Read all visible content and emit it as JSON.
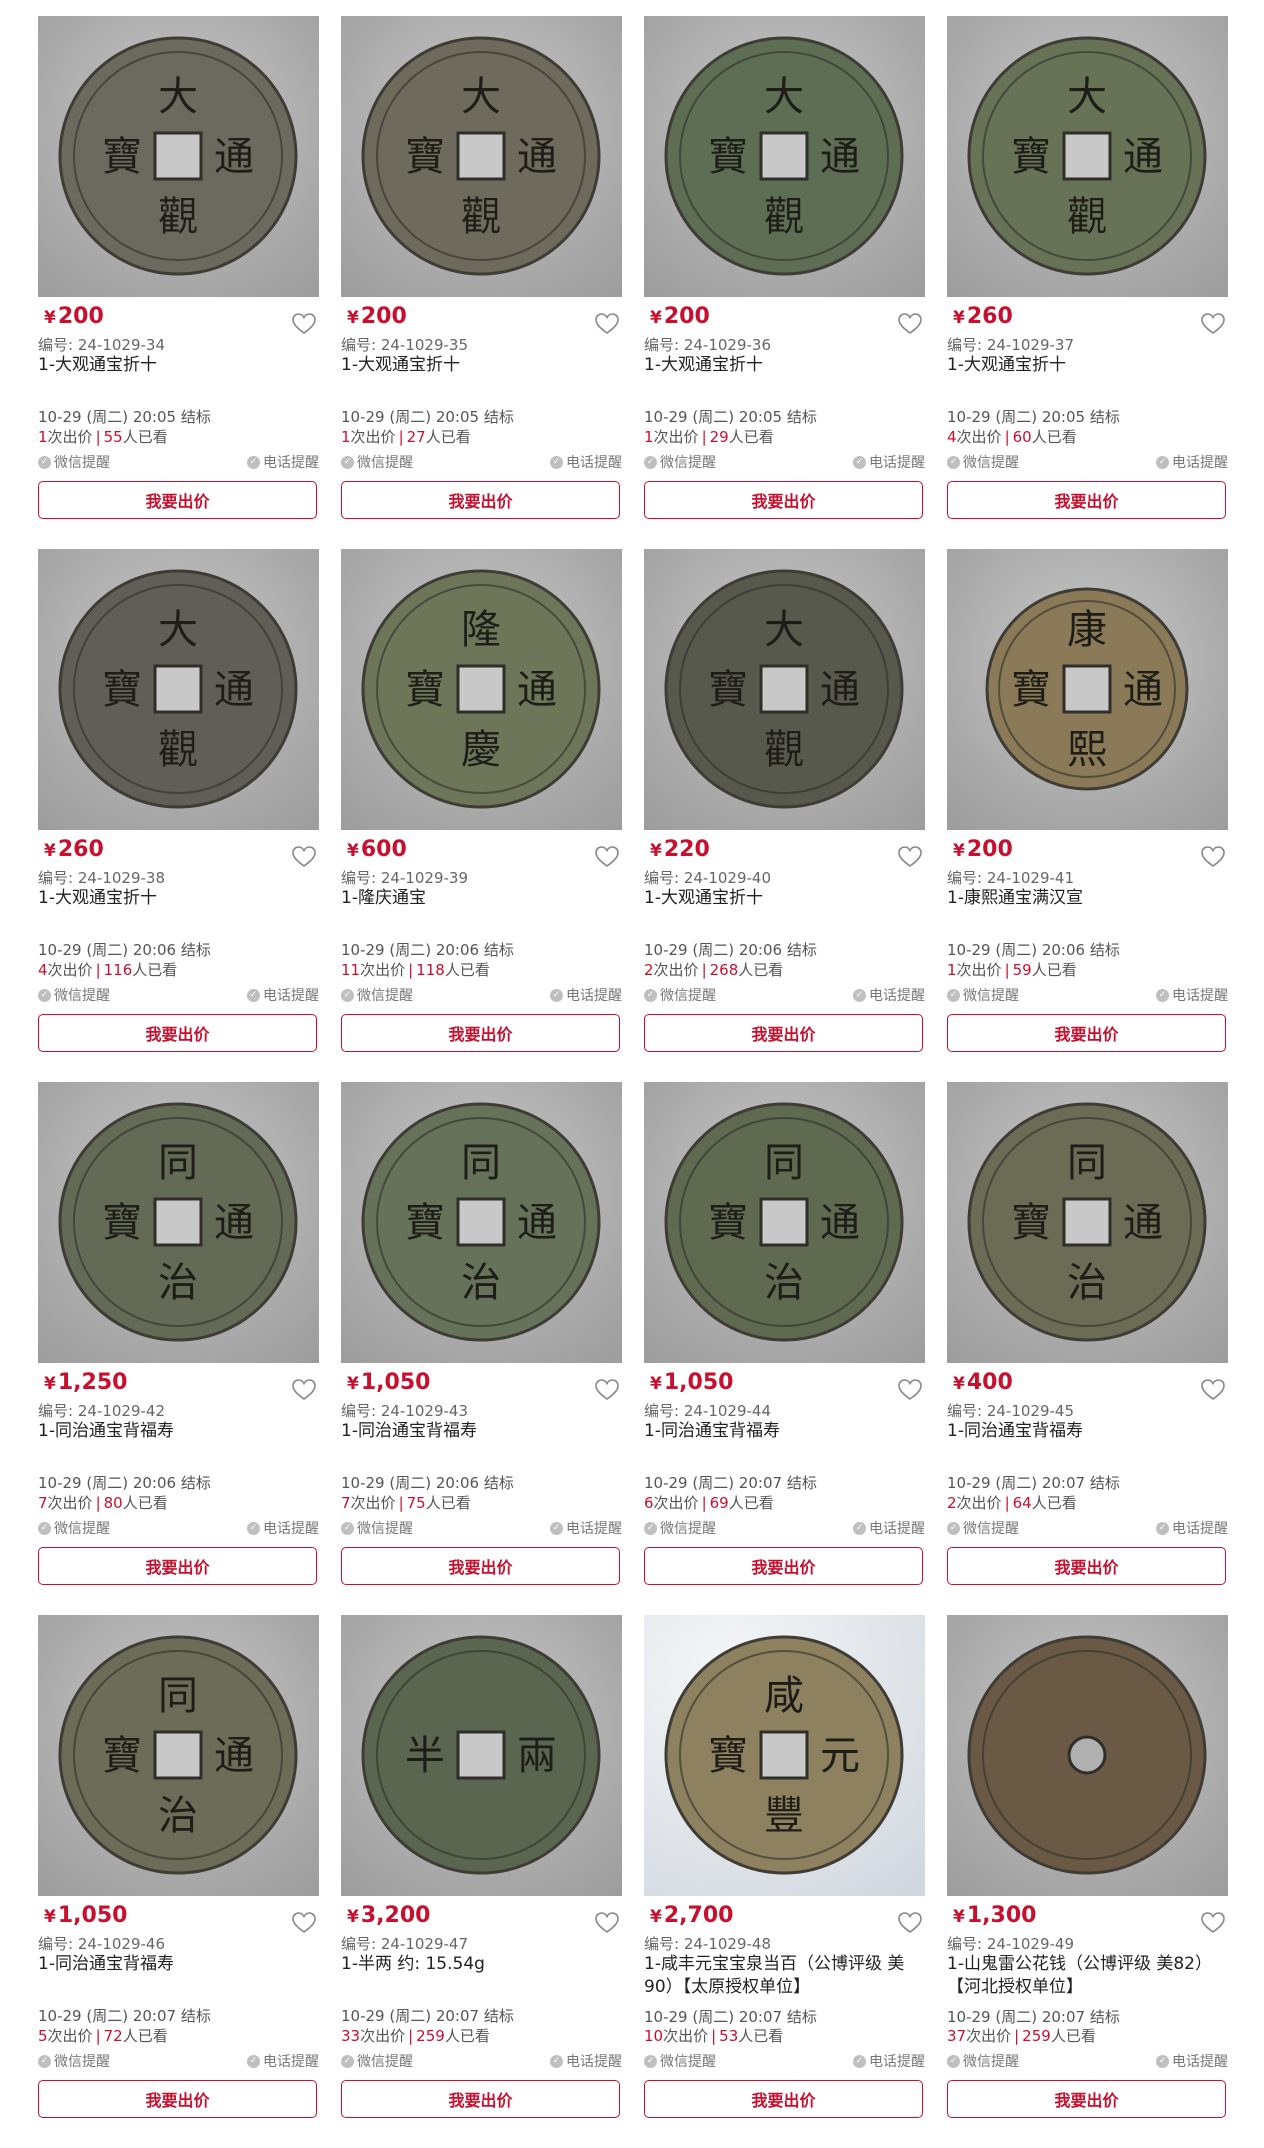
{
  "labels": {
    "serial_prefix": "编号: ",
    "bid_count_suffix": "次出价",
    "views_suffix": "人已看",
    "end_suffix": " 结标",
    "wechat_remind": "微信提醒",
    "phone_remind": "电话提醒",
    "bid_button": "我要出价",
    "currency": "¥"
  },
  "colors": {
    "accent": "#c8102e"
  },
  "icons": {
    "favorite": "heart-outline-icon",
    "remind": "check-circle-icon"
  },
  "items": [
    {
      "price": "200",
      "serial": "24-1029-34",
      "title": "1-大观通宝折十",
      "end": "10-29 (周二) 20:05",
      "bids": "1",
      "views": "55",
      "chars": [
        "大",
        "通",
        "觀",
        "寶"
      ],
      "patina": "#6b6a5e"
    },
    {
      "price": "200",
      "serial": "24-1029-35",
      "title": "1-大观通宝折十",
      "end": "10-29 (周二) 20:05",
      "bids": "1",
      "views": "27",
      "chars": [
        "大",
        "通",
        "觀",
        "寶"
      ],
      "patina": "#6e6a5c"
    },
    {
      "price": "200",
      "serial": "24-1029-36",
      "title": "1-大观通宝折十",
      "end": "10-29 (周二) 20:05",
      "bids": "1",
      "views": "29",
      "chars": [
        "大",
        "通",
        "觀",
        "寶"
      ],
      "patina": "#5d6e55"
    },
    {
      "price": "260",
      "serial": "24-1029-37",
      "title": "1-大观通宝折十",
      "end": "10-29 (周二) 20:05",
      "bids": "4",
      "views": "60",
      "chars": [
        "大",
        "通",
        "觀",
        "寶"
      ],
      "patina": "#687256"
    },
    {
      "price": "260",
      "serial": "24-1029-38",
      "title": "1-大观通宝折十",
      "end": "10-29 (周二) 20:06",
      "bids": "4",
      "views": "116",
      "chars": [
        "大",
        "通",
        "觀",
        "寶"
      ],
      "patina": "#5f5f57"
    },
    {
      "price": "600",
      "serial": "24-1029-39",
      "title": "1-隆庆通宝",
      "end": "10-29 (周二) 20:06",
      "bids": "11",
      "views": "118",
      "chars": [
        "隆",
        "通",
        "慶",
        "寶"
      ],
      "patina": "#6e7659"
    },
    {
      "price": "220",
      "serial": "24-1029-40",
      "title": "1-大观通宝折十",
      "end": "10-29 (周二) 20:06",
      "bids": "2",
      "views": "268",
      "chars": [
        "大",
        "通",
        "觀",
        "寶"
      ],
      "patina": "#56594c"
    },
    {
      "price": "200",
      "serial": "24-1029-41",
      "title": "1-康熙通宝满汉宣",
      "end": "10-29 (周二) 20:06",
      "bids": "1",
      "views": "59",
      "chars": [
        "康",
        "通",
        "熙",
        "寶"
      ],
      "patina": "#8a7a58"
    },
    {
      "price": "1,250",
      "serial": "24-1029-42",
      "title": "1-同治通宝背福寿",
      "end": "10-29 (周二) 20:06",
      "bids": "7",
      "views": "80",
      "chars": [
        "同",
        "通",
        "治",
        "寶"
      ],
      "patina": "#636a55"
    },
    {
      "price": "1,050",
      "serial": "24-1029-43",
      "title": "1-同治通宝背福寿",
      "end": "10-29 (周二) 20:06",
      "bids": "7",
      "views": "75",
      "chars": [
        "同",
        "通",
        "治",
        "寶"
      ],
      "patina": "#667259"
    },
    {
      "price": "1,050",
      "serial": "24-1029-44",
      "title": "1-同治通宝背福寿",
      "end": "10-29 (周二) 20:07",
      "bids": "6",
      "views": "69",
      "chars": [
        "同",
        "通",
        "治",
        "寶"
      ],
      "patina": "#5f6a50"
    },
    {
      "price": "400",
      "serial": "24-1029-45",
      "title": "1-同治通宝背福寿",
      "end": "10-29 (周二) 20:07",
      "bids": "2",
      "views": "64",
      "chars": [
        "同",
        "通",
        "治",
        "寶"
      ],
      "patina": "#6b6b56"
    },
    {
      "price": "1,050",
      "serial": "24-1029-46",
      "title": "1-同治通宝背福寿",
      "end": "10-29 (周二) 20:07",
      "bids": "5",
      "views": "72",
      "chars": [
        "同",
        "通",
        "治",
        "寶"
      ],
      "patina": "#6d6c58"
    },
    {
      "price": "3,200",
      "serial": "24-1029-47",
      "title": "1-半两 约: 15.54g",
      "end": "10-29 (周二) 20:07",
      "bids": "33",
      "views": "259",
      "chars": [
        "",
        "兩",
        "",
        "半"
      ],
      "patina": "#5b6650"
    },
    {
      "price": "2,700",
      "serial": "24-1029-48",
      "title": "1-咸丰元宝宝泉当百（公博评级 美90）【太原授权单位】",
      "end": "10-29 (周二) 20:07",
      "bids": "10",
      "views": "53",
      "chars": [
        "咸",
        "元",
        "豐",
        "寶"
      ],
      "patina": "#8d815f"
    },
    {
      "price": "1,300",
      "serial": "24-1029-49",
      "title": "1-山鬼雷公花钱（公博评级 美82）【河北授权单位】",
      "end": "10-29 (周二) 20:07",
      "bids": "37",
      "views": "259",
      "chars": [
        "",
        "",
        "",
        ""
      ],
      "patina": "#6a5a45"
    }
  ]
}
